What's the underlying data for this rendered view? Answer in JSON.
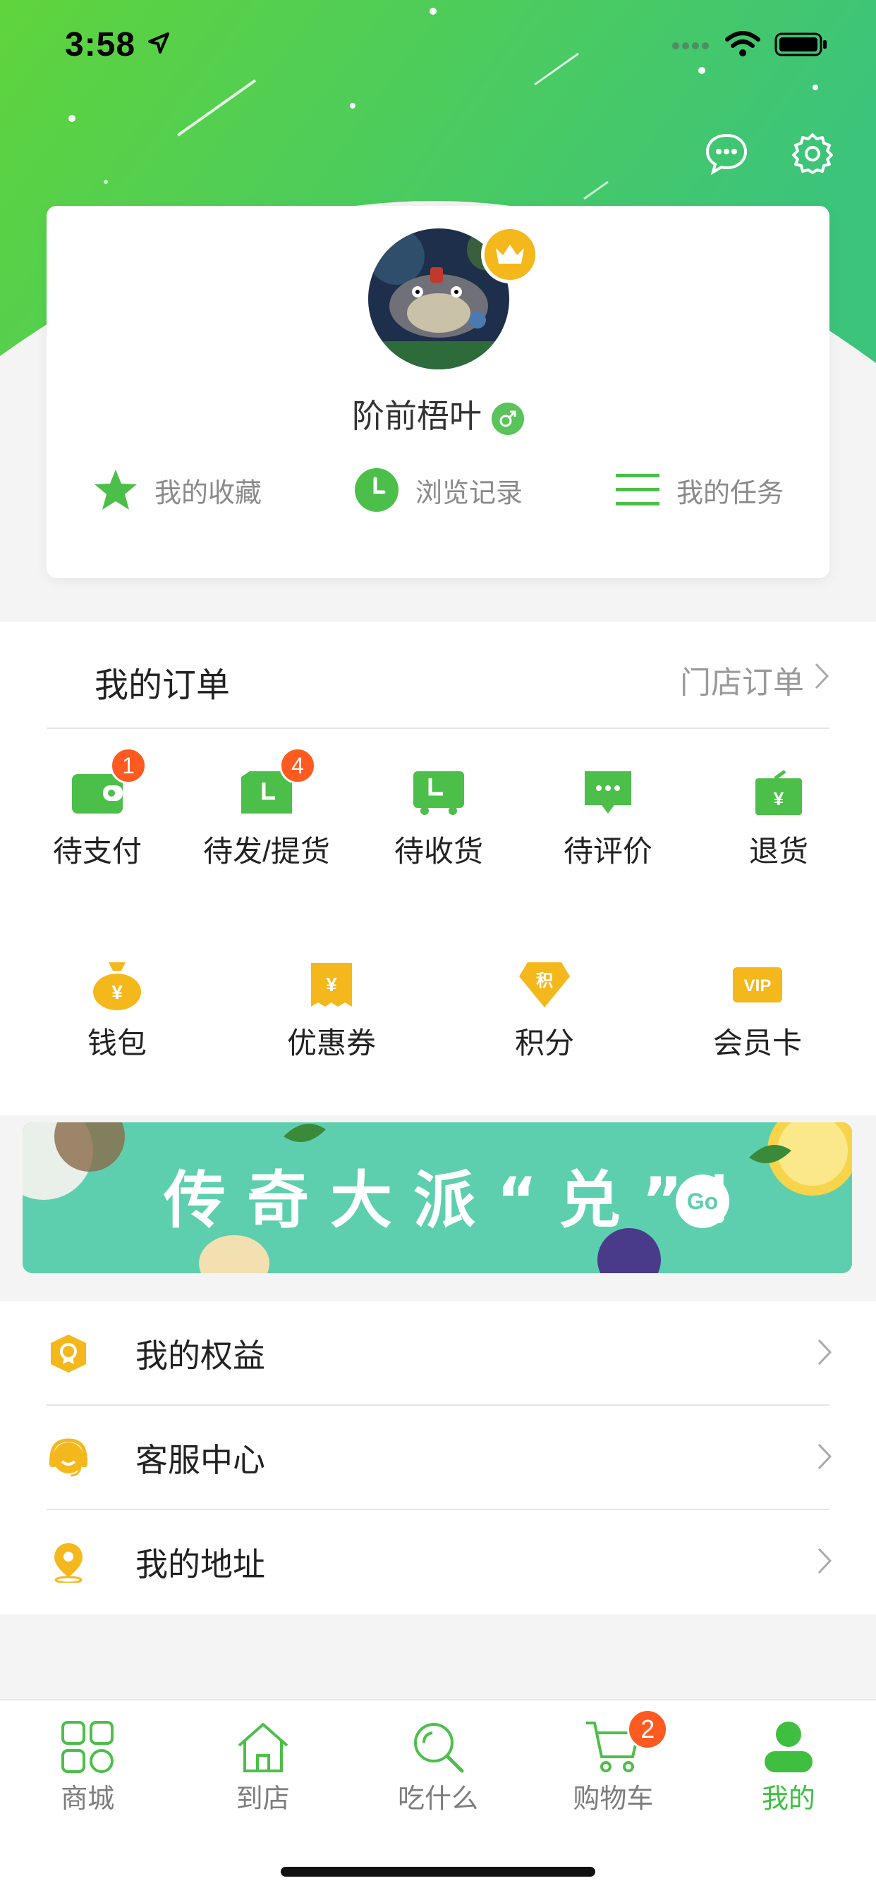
{
  "status_bar": {
    "time": "3:58"
  },
  "profile": {
    "name": "阶前梧叶"
  },
  "quick_links": [
    {
      "label": "我的收藏",
      "icon": "star-icon"
    },
    {
      "label": "浏览记录",
      "icon": "clock-icon"
    },
    {
      "label": "我的任务",
      "icon": "list-icon"
    }
  ],
  "orders": {
    "title": "我的订单",
    "store_orders": "门店订单",
    "statuses": [
      {
        "label": "待支付",
        "badge": "1"
      },
      {
        "label": "待发/提货",
        "badge": "4"
      },
      {
        "label": "待收货",
        "badge": ""
      },
      {
        "label": "待评价",
        "badge": ""
      },
      {
        "label": "退货",
        "badge": ""
      }
    ],
    "assets": [
      {
        "label": "钱包"
      },
      {
        "label": "优惠券"
      },
      {
        "label": "积分"
      },
      {
        "label": "会员卡"
      }
    ]
  },
  "banner": {
    "text": "传奇大派“兑”！",
    "go": "Go"
  },
  "menu": [
    {
      "label": "我的权益",
      "icon": "award-icon"
    },
    {
      "label": "客服中心",
      "icon": "headset-icon"
    },
    {
      "label": "我的地址",
      "icon": "location-pin-icon"
    }
  ],
  "tabbar": {
    "tabs": [
      {
        "label": "商城",
        "icon": "grid-icon",
        "active": false
      },
      {
        "label": "到店",
        "icon": "home-icon",
        "active": false
      },
      {
        "label": "吃什么",
        "icon": "search-icon",
        "active": false
      },
      {
        "label": "购物车",
        "icon": "cart-icon",
        "active": false,
        "badge": "2"
      },
      {
        "label": "我的",
        "icon": "person-icon",
        "active": true
      }
    ]
  },
  "colors": {
    "brand_green": "#3fbf3f",
    "badge_orange": "#ff5a1f",
    "gold": "#f5b81c"
  }
}
